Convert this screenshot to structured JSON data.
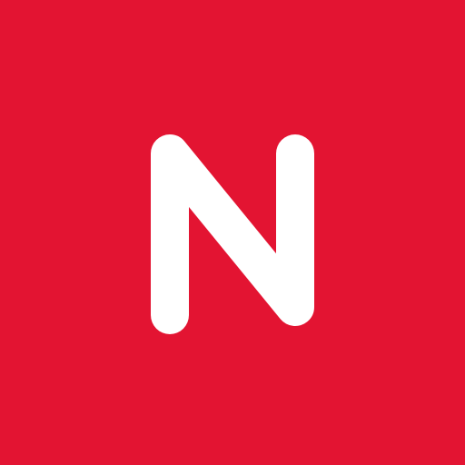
{
  "app_icon": {
    "logo_letter": "N",
    "background_color": "#e31432",
    "letter_color": "#ffffff"
  }
}
